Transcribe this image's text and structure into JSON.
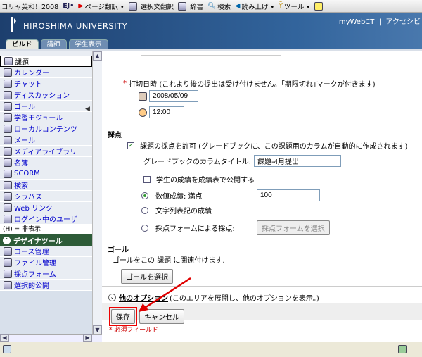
{
  "toolbar": {
    "ie_label": "コリャ英和！2008",
    "ej_label": "EJ•",
    "page_translate": "ページ翻訳 •",
    "selection_translate": "選択文翻訳",
    "dictionary": "辞書",
    "search": "検索",
    "read_aloud": "読み上げ •",
    "tools": "ツール •"
  },
  "header": {
    "university": "HIROSHIMA UNIVERSITY",
    "my_webct": "myWebCT",
    "accessibility": "アクセシビ",
    "tabs": [
      "ビルド",
      "講師",
      "学生表示"
    ]
  },
  "nav": {
    "items": [
      {
        "label": "課題",
        "icon": "assignment-icon",
        "selected": true
      },
      {
        "label": "カレンダー",
        "icon": "calendar-icon"
      },
      {
        "label": "チャット",
        "icon": "chat-icon"
      },
      {
        "label": "ディスカッション",
        "icon": "discussion-icon"
      },
      {
        "label": "ゴール",
        "icon": "goal-icon"
      },
      {
        "label": "学習モジュール",
        "icon": "module-icon"
      },
      {
        "label": "ローカルコンテンツ",
        "icon": "content-icon"
      },
      {
        "label": "メール",
        "icon": "mail-icon"
      },
      {
        "label": "メディアライブラリ",
        "icon": "media-icon"
      },
      {
        "label": "名簿",
        "icon": "roster-icon"
      },
      {
        "label": "SCORM",
        "icon": "scorm-icon"
      },
      {
        "label": "検索",
        "icon": "search-icon"
      },
      {
        "label": "シラバス",
        "icon": "syllabus-icon"
      },
      {
        "label": "Web リンク",
        "icon": "web-link-icon"
      },
      {
        "label": "ログイン中のユーザ",
        "icon": "users-online-icon"
      }
    ],
    "hidden_note": "(H) = 非表示",
    "designer_section": "デザイナツール",
    "designer_items": [
      {
        "label": "コース管理",
        "icon": "course-admin-icon"
      },
      {
        "label": "ファイル管理",
        "icon": "file-manager-icon"
      },
      {
        "label": "採点フォーム",
        "icon": "grading-form-icon"
      },
      {
        "label": "選択的公開",
        "icon": "release-icon"
      }
    ]
  },
  "form": {
    "deadline_label": "打切日時 (これより後の提出は受け付けません。｢期限切れ｣マークが付きます)",
    "date_value": "2008/05/09",
    "time_value": "12:00",
    "grading_title": "採点",
    "allow_grading_label": "課題の採点を許可 (グレードブックに、この課題用のカラムが自動的に作成されます)",
    "column_title_label": "グレードブックのカラムタイトル:",
    "column_title_value": "課題-4月提出",
    "publish_label": "学生の成績を成績表で公開する",
    "numeric_label": "数値成績: 満点",
    "numeric_value": "100",
    "text_grade_label": "文字列表記の成績",
    "form_grade_label": "採点フォームによる採点:",
    "select_form_button": "採点フォームを選択",
    "goals_title": "ゴール",
    "goals_desc": "ゴールをこの 課題 に関連付けます.",
    "select_goal_button": "ゴールを選択",
    "other_options_label": "他のオプション",
    "other_options_desc": "(このエリアを展開し、他のオプションを表示。)",
    "save_button": "保存",
    "cancel_button": "キャンセル",
    "required_note": "* 必須フィールド"
  },
  "colors": {
    "accent_red": "#e00000",
    "header_blue": "#27507f"
  }
}
